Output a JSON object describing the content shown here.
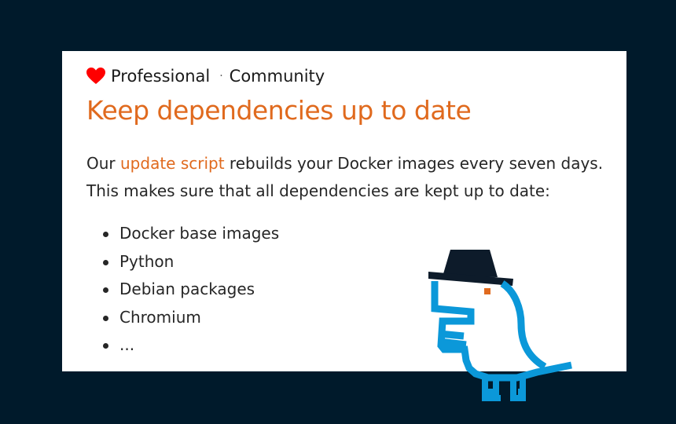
{
  "editions": {
    "icon": "heart-icon",
    "heart_color": "#ff0000",
    "professional": "Professional",
    "separator": "·",
    "community": "Community"
  },
  "title": "Keep dependencies up to date",
  "intro": {
    "prefix": "Our ",
    "link": "update script",
    "suffix": " rebuilds your Docker images every seven days. This makes sure that all dependencies are kept up to date:"
  },
  "dependencies": [
    "Docker base images",
    "Python",
    "Debian packages",
    "Chromium",
    "..."
  ],
  "mascot": {
    "icon": "bird-with-hat-illustration",
    "colors": {
      "body": "#0b98d9",
      "hat": "#0d1b2a",
      "eye": "#e06a1e"
    }
  },
  "colors": {
    "background": "#001a2b",
    "card": "#ffffff",
    "accent": "#e06a1e",
    "text": "#262626"
  }
}
